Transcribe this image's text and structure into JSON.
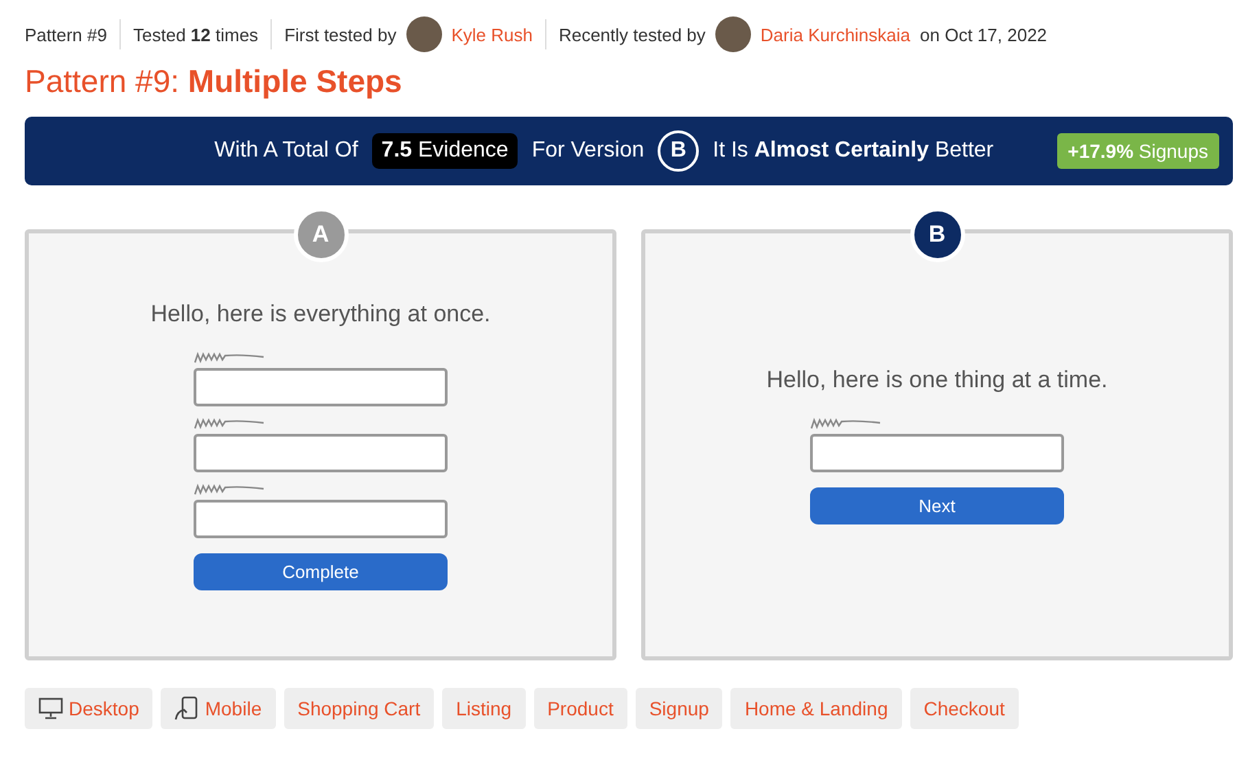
{
  "meta": {
    "pattern": "Pattern #9",
    "tested": "Tested **12** times",
    "first_label": "First tested by",
    "first_name": "Kyle Rush",
    "recent_label": "Recently tested by",
    "recent_name": "Daria Kurchinskaia",
    "recent_date": "on Oct 17, 2022"
  },
  "title": "Pattern #9: **Multiple Steps**",
  "banner": {
    "prefix": "With A Total Of",
    "evidence": "**7.5** Evidence",
    "for_version": "For Version",
    "version": "B",
    "verdict": "It Is **Almost Certainly** Better",
    "result": "**+17.9%** Signups"
  },
  "variants": [
    {
      "letter": "A",
      "winner": false,
      "heading": "Hello, here is everything at once.",
      "fields": [
        {
          "kind": "text"
        },
        {
          "kind": "text"
        },
        {
          "kind": "text"
        }
      ],
      "button": "Complete"
    },
    {
      "letter": "B",
      "winner": true,
      "heading": "Hello, here is one thing at a time.",
      "fields": [
        {
          "kind": "text"
        }
      ],
      "button": "Next"
    }
  ],
  "tags": [
    {
      "label": "Desktop",
      "kind": "desktop"
    },
    {
      "label": "Mobile",
      "kind": "mobile"
    },
    {
      "label": "Shopping Cart",
      "kind": "plain"
    },
    {
      "label": "Listing",
      "kind": "plain"
    },
    {
      "label": "Product",
      "kind": "plain"
    },
    {
      "label": "Signup",
      "kind": "plain"
    },
    {
      "label": "Home & Landing",
      "kind": "plain"
    },
    {
      "label": "Checkout",
      "kind": "plain"
    }
  ]
}
